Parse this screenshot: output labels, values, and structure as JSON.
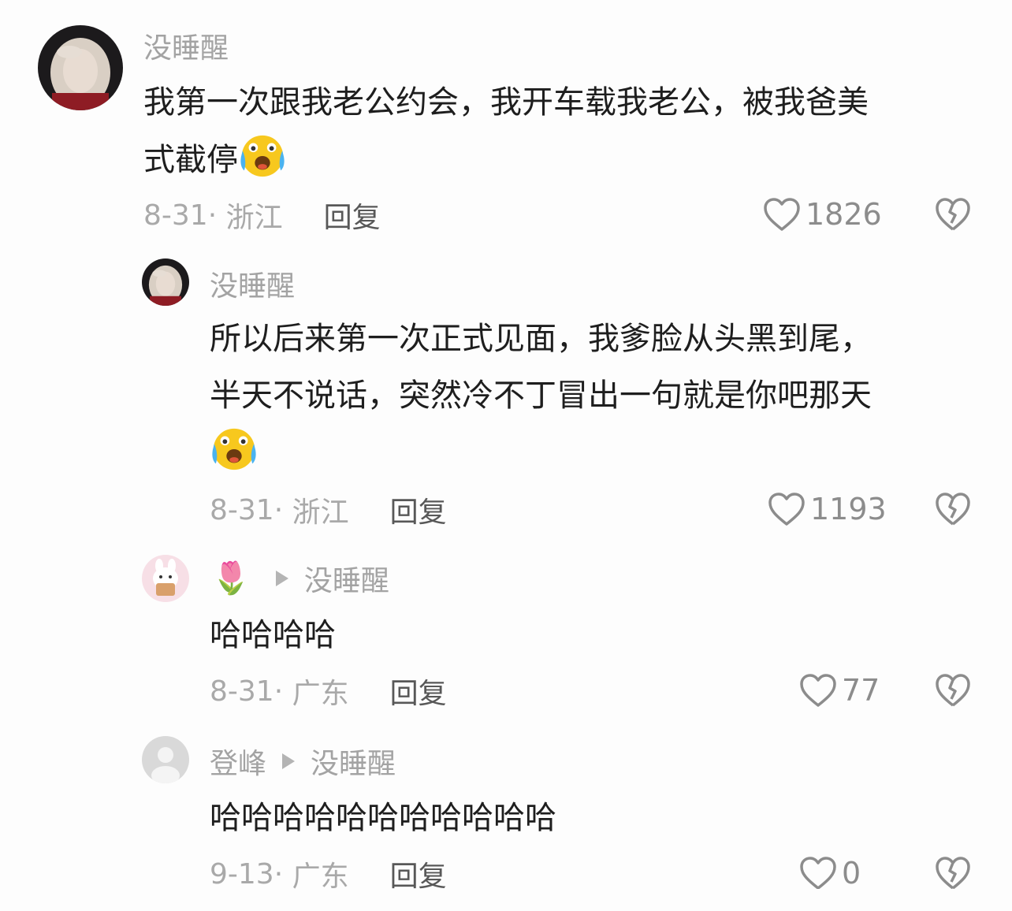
{
  "comments": [
    {
      "username": "没睡醒",
      "text_lines": [
        "我第一次跟我老公约会，我开车载我老公，被我爸美",
        "式截停"
      ],
      "has_emoji": true,
      "emoji": "loudly-crying-face",
      "date": "8-31",
      "location": "浙江",
      "reply_label": "回复",
      "likes": "1826"
    },
    {
      "username": "没睡醒",
      "text_lines": [
        "所以后来第一次正式见面，我爹脸从头黑到尾，",
        "半天不说话，突然冷不丁冒出一句就是你吧那天"
      ],
      "has_emoji": true,
      "emoji": "loudly-crying-face",
      "date": "8-31",
      "location": "浙江",
      "reply_label": "回复",
      "likes": "1193"
    },
    {
      "username_icon": "tulip",
      "reply_to": "没睡醒",
      "text_lines": [
        "哈哈哈哈"
      ],
      "date": "8-31",
      "location": "广东",
      "reply_label": "回复",
      "likes": "77"
    },
    {
      "username": "登峰",
      "reply_to": "没睡醒",
      "text_lines": [
        "哈哈哈哈哈哈哈哈哈哈哈"
      ],
      "date": "9-13",
      "location": "广东",
      "reply_label": "回复",
      "likes": "0"
    }
  ],
  "colors": {
    "background": "#fdfdfd",
    "text": "#1e1e1e",
    "username": "#a3a3a3",
    "meta": "#a9a9a9",
    "reply": "#585858",
    "icon": "#8c8c8c"
  }
}
